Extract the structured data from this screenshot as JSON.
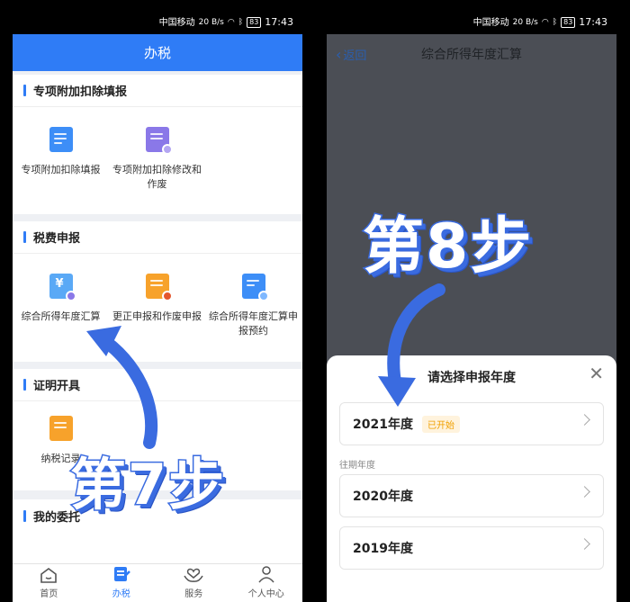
{
  "status": {
    "carrier": "中国移动",
    "speed": "20 B/s",
    "battery": "83",
    "time": "17:43"
  },
  "left": {
    "header_title": "办税",
    "sections": [
      {
        "title": "专项附加扣除填报",
        "tiles": [
          {
            "label": "专项附加扣除填报",
            "icon": "document-edit-icon",
            "color": "#3d8ef7"
          },
          {
            "label": "专项附加扣除修改和作废",
            "icon": "document-settings-icon",
            "color": "#8a78e8"
          }
        ]
      },
      {
        "title": "税费申报",
        "tiles": [
          {
            "label": "综合所得年度汇算",
            "icon": "yuan-document-icon",
            "color": "#5aa9f6"
          },
          {
            "label": "更正申报和作废申报",
            "icon": "document-cancel-icon",
            "color": "#f7a22b"
          },
          {
            "label": "综合所得年度汇算申报预约",
            "icon": "document-clock-icon",
            "color": "#3d8ef7"
          }
        ]
      },
      {
        "title": "证明开具",
        "tiles": [
          {
            "label": "纳税记录",
            "icon": "certificate-icon",
            "color": "#f7a22b"
          }
        ]
      },
      {
        "title": "我的委托",
        "tiles": []
      }
    ],
    "tabs": [
      {
        "label": "首页",
        "icon": "home-icon",
        "active": false
      },
      {
        "label": "办税",
        "icon": "tax-doc-icon",
        "active": true
      },
      {
        "label": "服务",
        "icon": "heart-hands-icon",
        "active": false
      },
      {
        "label": "个人中心",
        "icon": "person-icon",
        "active": false
      }
    ],
    "step_sticker": "第7步"
  },
  "right": {
    "back_label": "返回",
    "header_title": "综合所得年度汇算",
    "step_sticker": "第8步",
    "sheet": {
      "title": "请选择申报年度",
      "current": {
        "year": "2021年度",
        "badge": "已开始"
      },
      "past_label": "往期年度",
      "past_years": [
        "2020年度",
        "2019年度"
      ]
    }
  },
  "colors": {
    "brand_blue": "#2f7cf6",
    "sticker_blue": "#3a6be0",
    "badge_orange": "#f0a000"
  }
}
